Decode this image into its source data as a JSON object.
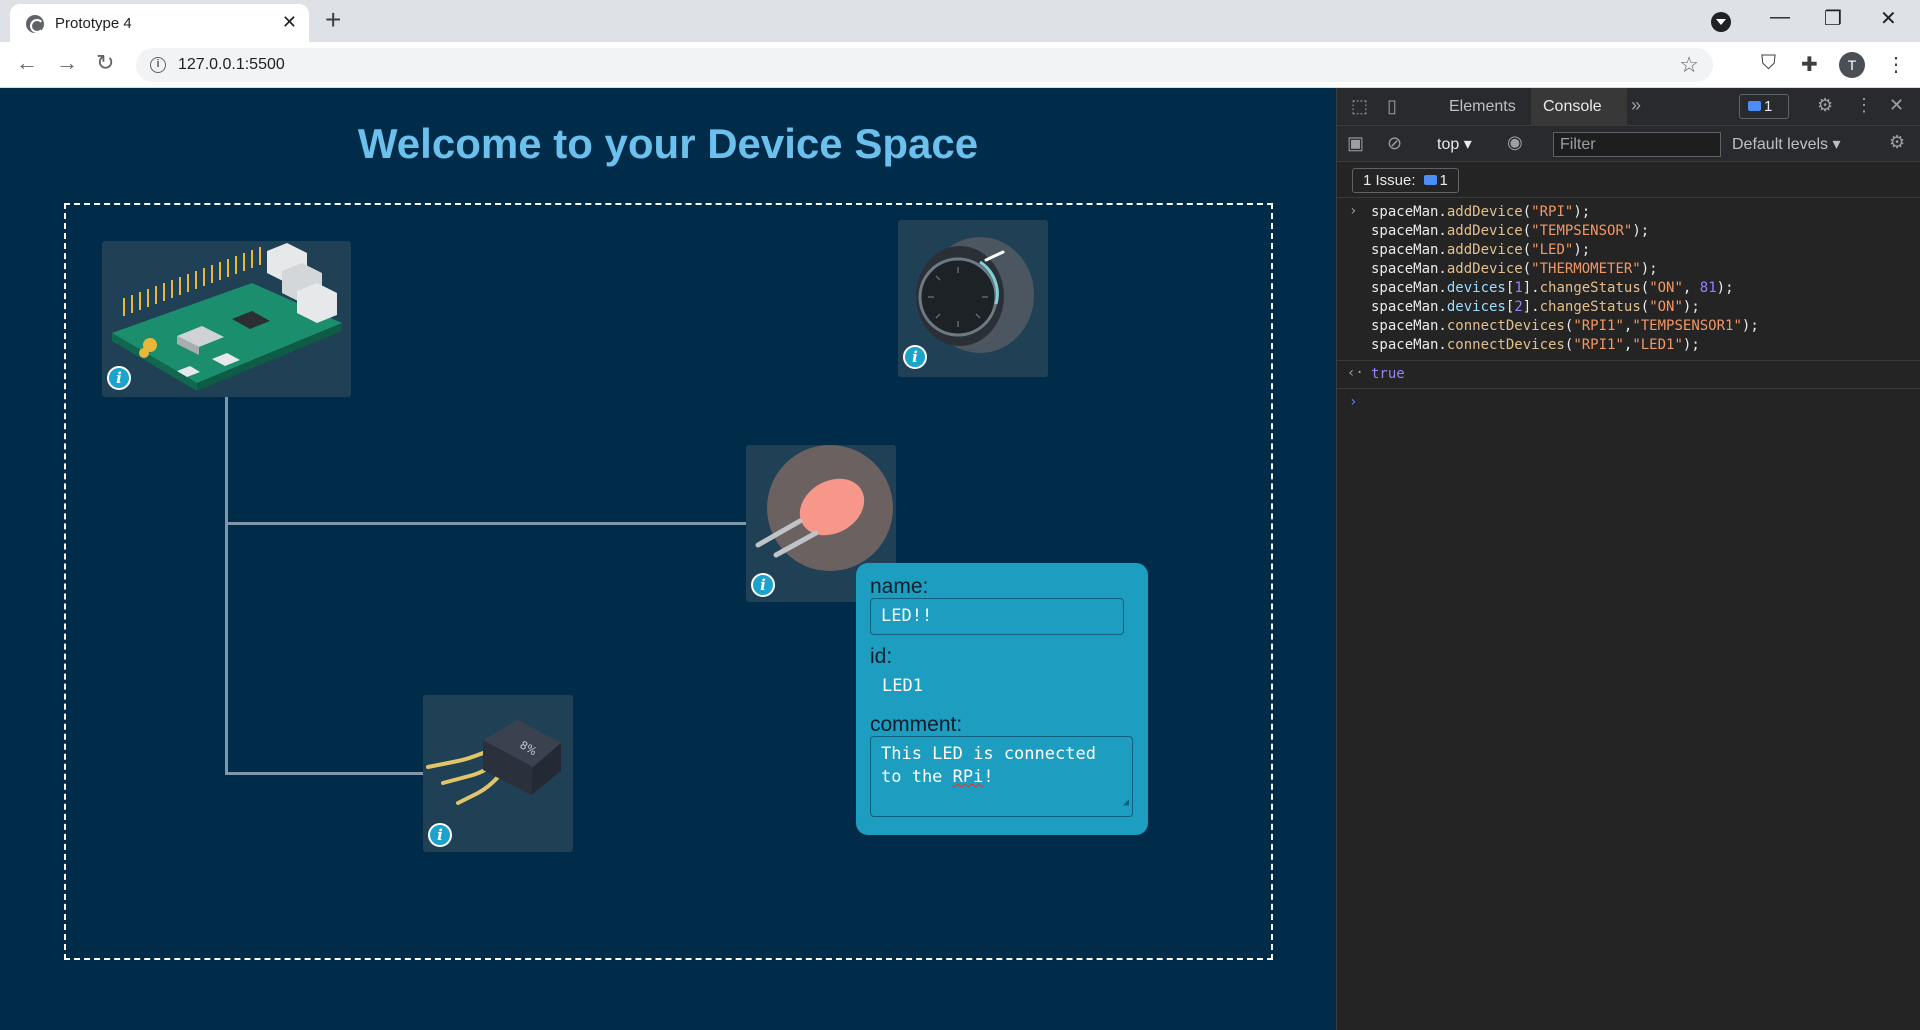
{
  "browser": {
    "tab_title": "Prototype 4",
    "url": "127.0.0.1:5500",
    "profile_initial": "T"
  },
  "page": {
    "title": "Welcome to your Device Space",
    "devices": [
      {
        "name": "raspberry-pi",
        "icon": "raspberry-pi-board"
      },
      {
        "name": "thermometer",
        "icon": "thermometer-dial"
      },
      {
        "name": "led",
        "icon": "led-bulb"
      },
      {
        "name": "temp-sensor",
        "icon": "transistor-sensor"
      }
    ],
    "popup": {
      "name_label": "name:",
      "name_value": "LED!!",
      "id_label": "id:",
      "id_value": "LED1",
      "comment_label": "comment:",
      "comment_line1": "This LED is connected",
      "comment_line2_pre": "to the ",
      "comment_line2_word": "RPi",
      "comment_line2_post": "!"
    },
    "colors": {
      "accent": "#6cc0ed",
      "background": "#002b49",
      "popup": "#1d9dc0",
      "wire": "#7f97a8"
    }
  },
  "devtools": {
    "tabs": [
      "Elements",
      "Console"
    ],
    "issue_count_badge": "1",
    "context": "top",
    "filter_placeholder": "Filter",
    "levels": "Default levels",
    "issues_label": "1 Issue:",
    "issues_count": "1",
    "console_commands": [
      {
        "obj": "spaceMan.",
        "fn": "addDevice",
        "args": [
          {
            "t": "str",
            "v": "\"RPI\""
          }
        ]
      },
      {
        "obj": "spaceMan.",
        "fn": "addDevice",
        "args": [
          {
            "t": "str",
            "v": "\"TEMPSENSOR\""
          }
        ]
      },
      {
        "obj": "spaceMan.",
        "fn": "addDevice",
        "args": [
          {
            "t": "str",
            "v": "\"LED\""
          }
        ]
      },
      {
        "obj": "spaceMan.",
        "fn": "addDevice",
        "args": [
          {
            "t": "str",
            "v": "\"THERMOMETER\""
          }
        ]
      },
      {
        "obj": "spaceMan.",
        "prop": "devices",
        "index": "1",
        "fn": "changeStatus",
        "args": [
          {
            "t": "str",
            "v": "\"ON\""
          },
          {
            "t": "num",
            "v": "81"
          }
        ]
      },
      {
        "obj": "spaceMan.",
        "prop": "devices",
        "index": "2",
        "fn": "changeStatus",
        "args": [
          {
            "t": "str",
            "v": "\"ON\""
          }
        ]
      },
      {
        "obj": "spaceMan.",
        "fn": "connectDevices",
        "args": [
          {
            "t": "str",
            "v": "\"RPI1\""
          },
          {
            "t": "str",
            "v": "\"TEMPSENSOR1\""
          }
        ]
      },
      {
        "obj": "spaceMan.",
        "fn": "connectDevices",
        "args": [
          {
            "t": "str",
            "v": "\"RPI1\""
          },
          {
            "t": "str",
            "v": "\"LED1\""
          }
        ]
      }
    ],
    "result": "true"
  }
}
